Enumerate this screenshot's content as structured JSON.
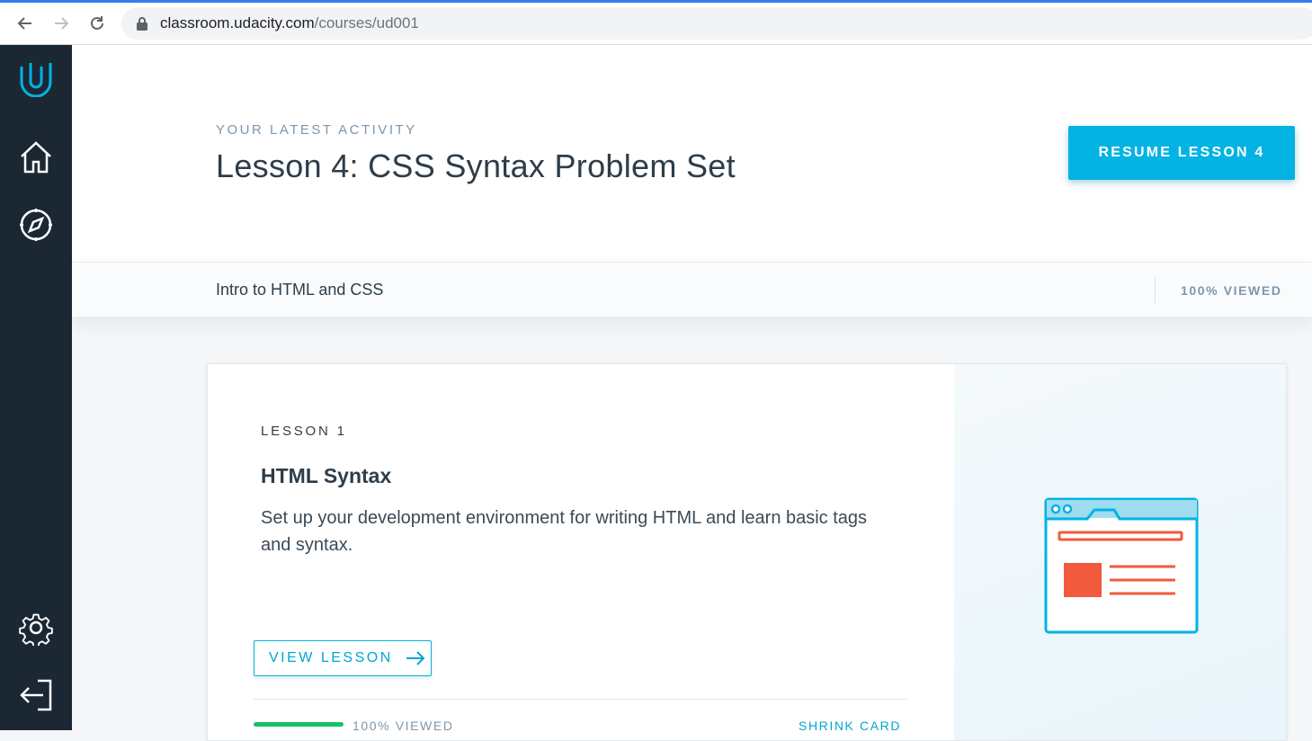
{
  "browser": {
    "url_host": "classroom.udacity.com",
    "url_path": "/courses/ud001"
  },
  "header": {
    "kicker": "YOUR LATEST ACTIVITY",
    "title": "Lesson 4: CSS Syntax Problem Set",
    "resume_label": "RESUME LESSON 4"
  },
  "course_strip": {
    "course_name": "Intro to HTML and CSS",
    "viewed": "100% VIEWED",
    "progress": 1.0
  },
  "lesson_card": {
    "number": "LESSON 1",
    "title": "HTML Syntax",
    "description": "Set up your development environment for writing HTML and learn basic tags and syntax.",
    "view_label": "VIEW LESSON",
    "viewed": "100% VIEWED",
    "progress": 1.0,
    "shrink_label": "SHRINK CARD"
  },
  "sidebar": {
    "items": [
      "logo-icon",
      "home-icon",
      "compass-icon",
      "settings-icon",
      "logout-icon"
    ]
  },
  "colors": {
    "accent": "#02b3e4",
    "sidebar": "#1b2733",
    "progress": "#15c26b",
    "illustration_red": "#f15a3d"
  }
}
